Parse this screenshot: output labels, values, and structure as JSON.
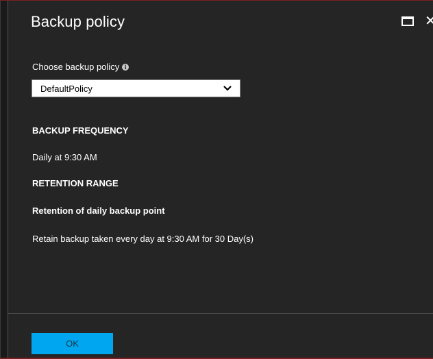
{
  "header": {
    "title": "Backup policy"
  },
  "form": {
    "policy_label": "Choose backup policy",
    "info_glyph": "i",
    "policy_selected": "DefaultPolicy"
  },
  "details": {
    "frequency_heading": "BACKUP FREQUENCY",
    "frequency_value": "Daily at 9:30 AM",
    "retention_heading": "RETENTION RANGE",
    "retention_subheading": "Retention of daily backup point",
    "retention_value": "Retain backup taken every day at 9:30 AM for 30 Day(s)"
  },
  "footer": {
    "ok_label": "OK"
  },
  "colors": {
    "background": "#252526",
    "accent": "#00a6f0",
    "text": "#ffffff"
  },
  "icons": {
    "maximize": "maximize-icon",
    "close": "close-icon",
    "info": "info-icon",
    "chevron": "chevron-down-icon"
  }
}
